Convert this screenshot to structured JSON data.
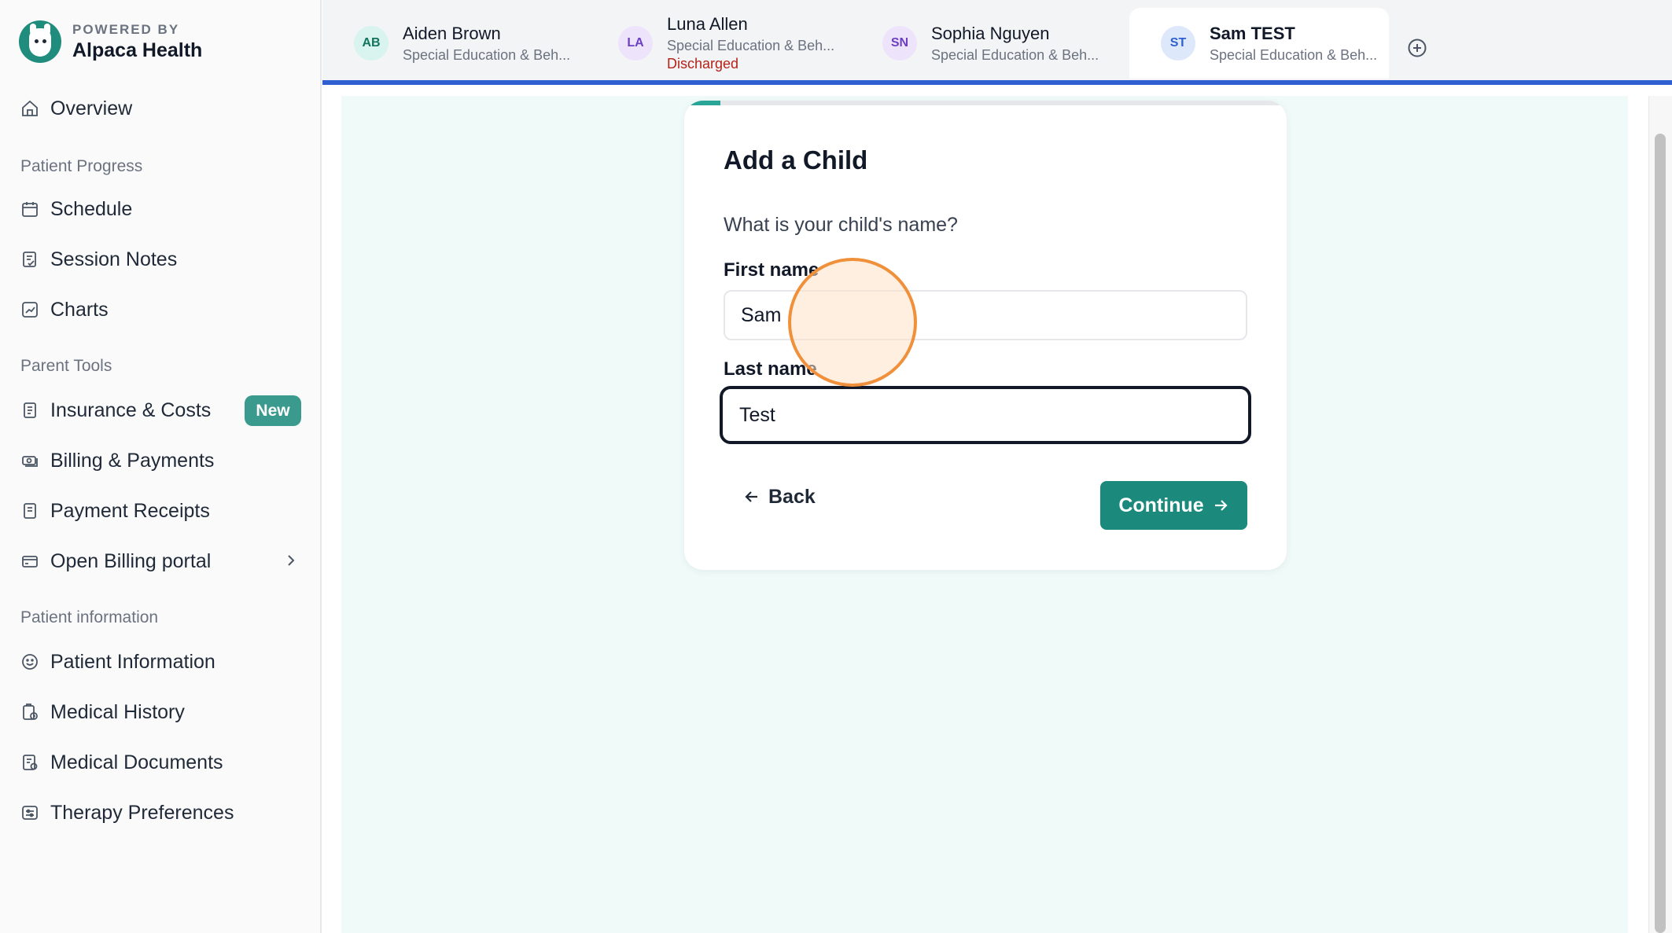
{
  "brand": {
    "powered_by": "POWERED BY",
    "name": "Alpaca Health"
  },
  "sidebar": {
    "overview": "Overview",
    "sections": {
      "patient_progress": "Patient Progress",
      "parent_tools": "Parent Tools",
      "patient_information": "Patient information"
    },
    "items": {
      "schedule": "Schedule",
      "session_notes": "Session Notes",
      "charts": "Charts",
      "insurance": "Insurance & Costs",
      "insurance_badge": "New",
      "billing": "Billing & Payments",
      "receipts": "Payment Receipts",
      "billing_portal": "Open Billing portal",
      "patient_info": "Patient Information",
      "medical_history": "Medical History",
      "medical_documents": "Medical Documents",
      "therapy_preferences": "Therapy Preferences"
    }
  },
  "tabs": [
    {
      "initials": "AB",
      "name": "Aiden Brown",
      "subtitle": "Special Education & Beh...",
      "status": ""
    },
    {
      "initials": "LA",
      "name": "Luna Allen",
      "subtitle": "Special Education & Beh...",
      "status": "Discharged"
    },
    {
      "initials": "SN",
      "name": "Sophia Nguyen",
      "subtitle": "Special Education & Beh...",
      "status": ""
    },
    {
      "initials": "ST",
      "name": "Sam TEST",
      "subtitle": "Special Education & Beh...",
      "status": ""
    }
  ],
  "form": {
    "title": "Add a Child",
    "question": "What is your child's name?",
    "first_name_label": "First name",
    "first_name_value": "Sam",
    "last_name_label": "Last name",
    "last_name_value": "Test",
    "back_label": "Back",
    "continue_label": "Continue",
    "progress_fraction": 0.06
  },
  "colors": {
    "accent": "#1b8a7c",
    "tab_underline": "#2f5fd0",
    "badge": "#3a9a8e",
    "discharged": "#b42318",
    "main_background": "#f0faf8"
  }
}
